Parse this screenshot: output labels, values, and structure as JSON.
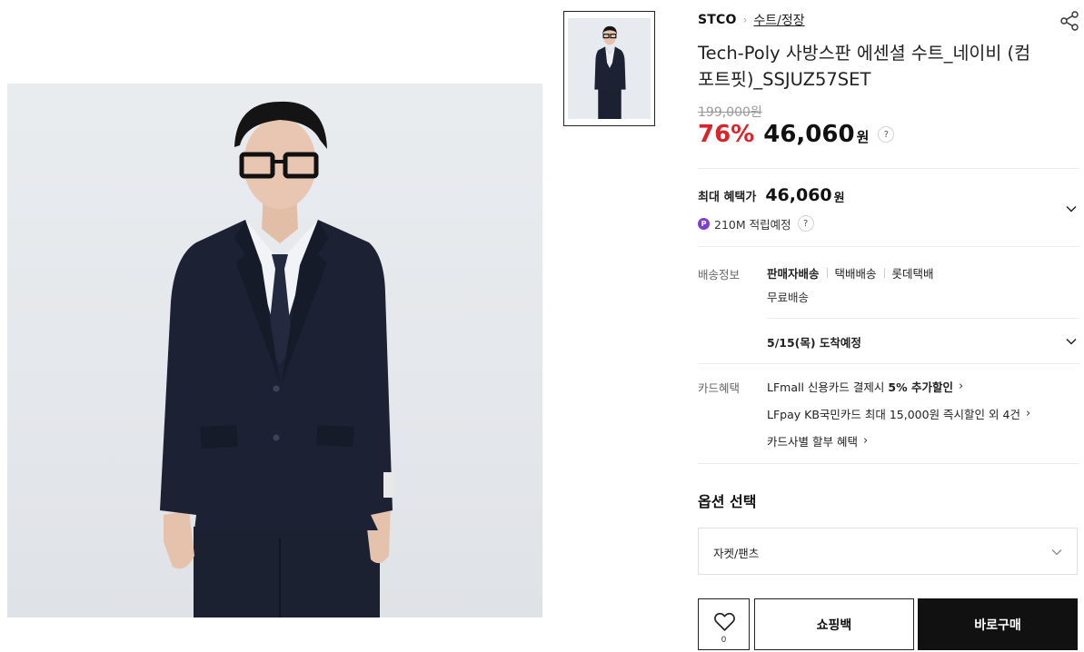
{
  "breadcrumb": {
    "brand": "STCO",
    "separator": "›",
    "category": "수트/정장"
  },
  "product": {
    "title": "Tech-Poly 사방스판 에센셜 수트_네이비 (컴포트핏)_SSJUZ57SET",
    "original_price": "199,000원",
    "discount_rate": "76%",
    "sale_price": "46,060",
    "currency_unit": "원",
    "help_mark": "?"
  },
  "benefit": {
    "label": "최대 혜택가",
    "price": "46,060",
    "unit": "원",
    "points_badge": "P",
    "points_text": "210M 적립예정"
  },
  "shipping": {
    "label": "배송정보",
    "methods": [
      "판매자배송",
      "택배배송",
      "롯데택배"
    ],
    "active_method_index": 0,
    "fee": "무료배송",
    "arrival": "5/15(목) 도착예정"
  },
  "card": {
    "label": "카드혜택",
    "line1_prefix": "LFmall 신용카드 결제시",
    "line1_bold": "5% 추가할인",
    "line2": "LFpay KB국민카드 최대 15,000원 즉시할인 외 4건",
    "line3": "카드사별 할부 혜택",
    "arrow": "›"
  },
  "options": {
    "title": "옵션 선택",
    "selected": "자켓/팬츠"
  },
  "actions": {
    "wish_count": "0",
    "bag_label": "쇼핑백",
    "buy_label": "바로구매"
  },
  "colors": {
    "discount": "#d7262b",
    "points_badge": "#7b3fd1",
    "buy_button": "#111111",
    "suit_navy": "#1c2233"
  },
  "icons": [
    "share-icon",
    "chevron-down-icon",
    "heart-icon",
    "help-icon",
    "points-icon"
  ]
}
